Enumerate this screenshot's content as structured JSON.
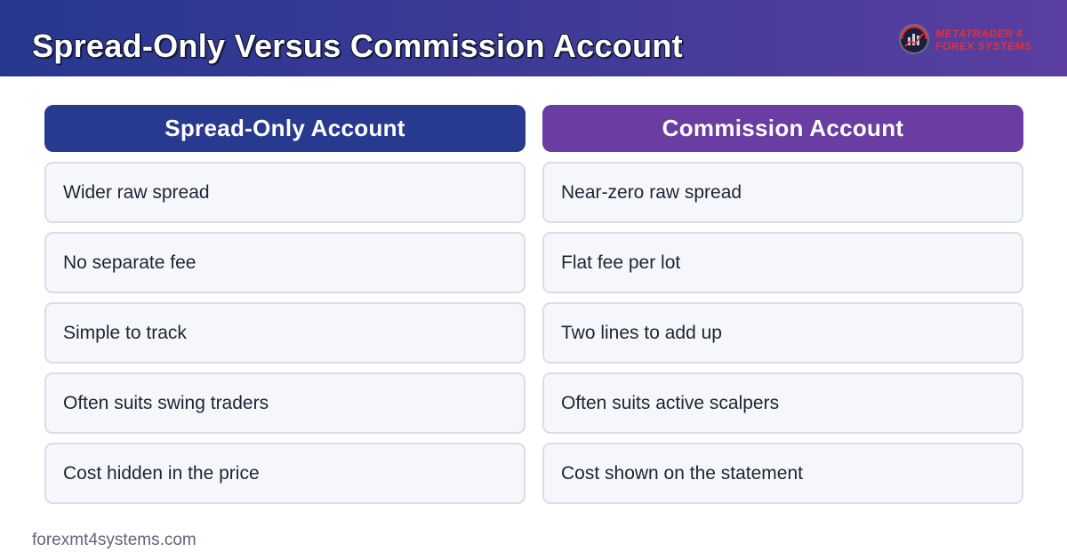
{
  "header": {
    "title": "Spread-Only Versus Commission Account",
    "logo": {
      "line1": "MetaTrader 4",
      "line2": "Forex Systems",
      "icon": "globe-chart-icon"
    }
  },
  "columns": [
    {
      "title": "Spread-Only Account",
      "color": "#283a8f",
      "items": [
        "Wider raw spread",
        "No separate fee",
        "Simple to track",
        "Often suits swing traders",
        "Cost hidden in the price"
      ]
    },
    {
      "title": "Commission Account",
      "color": "#6a3da2",
      "items": [
        "Near-zero raw spread",
        "Flat fee per lot",
        "Two lines to add up",
        "Often suits active scalpers",
        "Cost shown on the statement"
      ]
    }
  ],
  "footer": {
    "site": "forexmt4systems.com"
  }
}
